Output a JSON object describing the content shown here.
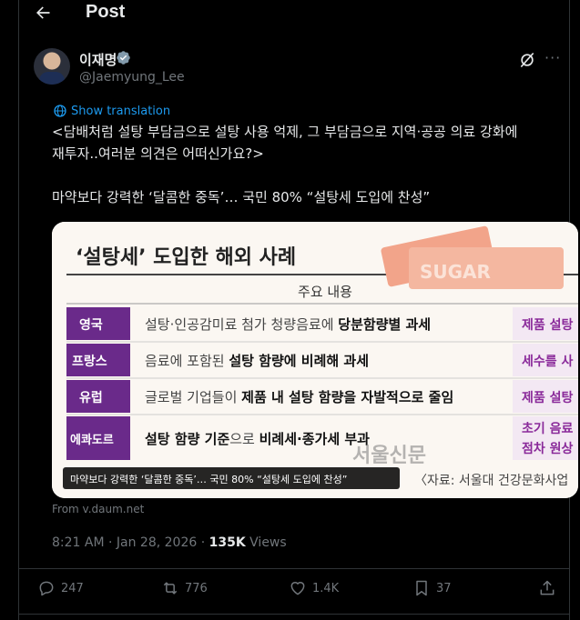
{
  "header": {
    "back_icon": "arrow-left-icon",
    "title": "Post"
  },
  "author": {
    "name": "이재명",
    "handle": "@Jaemyung_Lee",
    "verified_color": "#1d9bf0"
  },
  "translate_label": "Show translation",
  "post": {
    "line1": "<담배처럼 설탕 부담금으로 설탕 사용 억제, 그 부담금으로 지역·공공 의료 강화에\n재투자..여러분 의견은 어떠신가요?>",
    "line2": "마약보다 강력한 ‘달콤한 중독’… 국민 80% “설탕세 도입에 찬성”"
  },
  "card": {
    "title": "‘설탕세’ 도입한 해외 사례",
    "column_header": "주요 내용",
    "sugar_label": "SUGAR",
    "rows": [
      {
        "country": "영국",
        "text_plain": "설탕·인공감미료 첨가 청량음료에 ",
        "text_bold": "당분함량별 과세",
        "right": "제품 설탕"
      },
      {
        "country": "프랑스",
        "text_plain": "음료에 포함된 ",
        "text_bold": "설탕 함량에 비례해 과세",
        "right": "세수를 사"
      },
      {
        "country": "유럽",
        "text_plain": "글로벌 기업들이 ",
        "text_bold": "제품 내 설탕 함량을 자발적으로 줄임",
        "right": "제품 설탕"
      },
      {
        "country": "에콰도르",
        "text_bold": "설탕 함량 기준",
        "text_plain": "으로 ",
        "text_bold2": "비례세·종가세 부과",
        "right": "초기 음료",
        "right2": "점차 원상"
      }
    ],
    "watermark": "서울신문",
    "caption": "마약보다 강력한 ‘달콤한 중독’… 국민 80% “설탕세 도입에 찬성”",
    "credit": "〈자료: 서울대 건강문화사업"
  },
  "source_text": "From v.daum.net",
  "meta": {
    "time": "8:21 AM · Jan 28, 2026 · ",
    "views_count": "135K",
    "views_label": " Views"
  },
  "actions": {
    "replies": "247",
    "reposts": "776",
    "likes": "1.4K",
    "bookmarks": "37"
  },
  "colors": {
    "accent": "#1d9bf0",
    "purple": "#6a2a8a",
    "muted": "#71767b"
  }
}
